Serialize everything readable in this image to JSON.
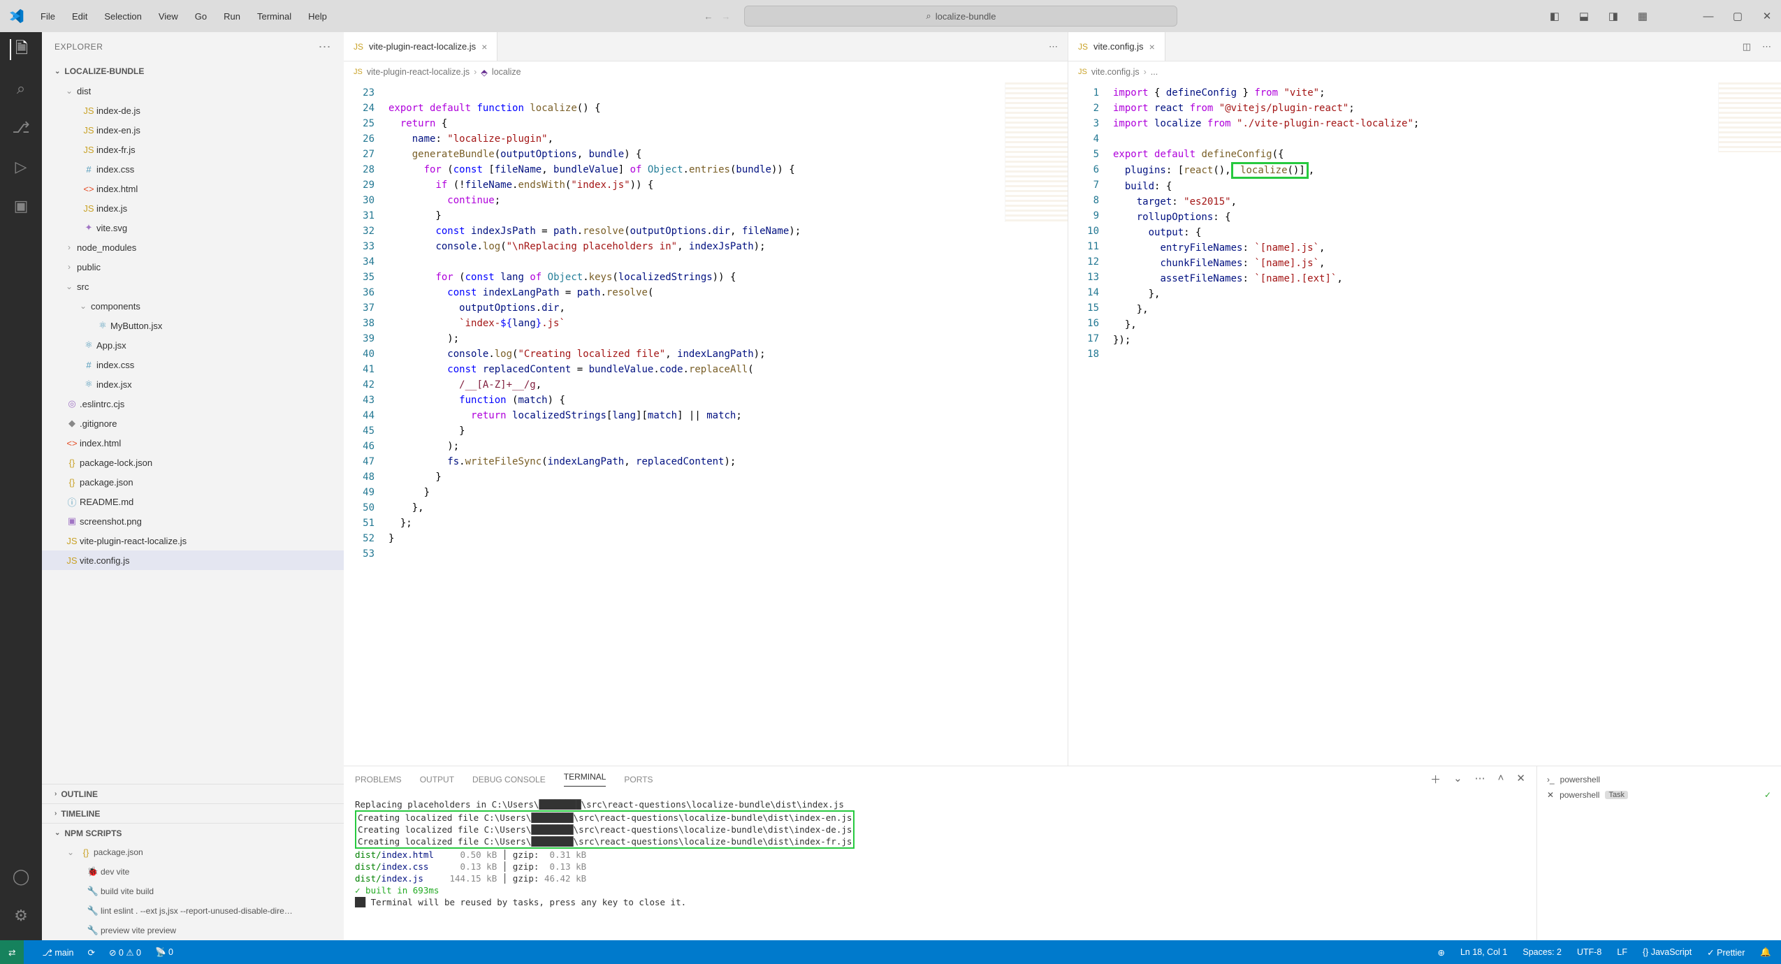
{
  "menu": [
    "File",
    "Edit",
    "Selection",
    "View",
    "Go",
    "Run",
    "Terminal",
    "Help"
  ],
  "search_value": "localize-bundle",
  "explorer_title": "EXPLORER",
  "project_name": "LOCALIZE-BUNDLE",
  "tree": {
    "dist": "dist",
    "items_dist": [
      {
        "icon": "JS",
        "cls": "js-color",
        "label": "index-de.js"
      },
      {
        "icon": "JS",
        "cls": "js-color",
        "label": "index-en.js"
      },
      {
        "icon": "JS",
        "cls": "js-color",
        "label": "index-fr.js"
      },
      {
        "icon": "#",
        "cls": "css-color",
        "label": "index.css"
      },
      {
        "icon": "<>",
        "cls": "html-color",
        "label": "index.html"
      },
      {
        "icon": "JS",
        "cls": "js-color",
        "label": "index.js"
      },
      {
        "icon": "✦",
        "cls": "img-color",
        "label": "vite.svg"
      }
    ],
    "node_modules": "node_modules",
    "public": "public",
    "src": "src",
    "components": "components",
    "mybutton": "MyButton.jsx",
    "appjsx": "App.jsx",
    "indexcss": "index.css",
    "indexjs": "index.jsx",
    "eslintrc": ".eslintrc.cjs",
    "gitignore": ".gitignore",
    "indexhtml": "index.html",
    "pkglock": "package-lock.json",
    "pkg": "package.json",
    "readme": "README.md",
    "screenshot": "screenshot.png",
    "viteplugin": "vite-plugin-react-localize.js",
    "viteconfig": "vite.config.js"
  },
  "aux": {
    "outline": "OUTLINE",
    "timeline": "TIMELINE",
    "npm": "NPM SCRIPTS"
  },
  "npm_scripts": {
    "pkg": "package.json",
    "dev": "dev vite",
    "build": "build vite build",
    "lint": "lint eslint . --ext js,jsx --report-unused-disable-dire…",
    "preview": "preview vite preview"
  },
  "tab_left": "vite-plugin-react-localize.js",
  "tab_right": "vite.config.js",
  "breadcrumbs_left": [
    "vite-plugin-react-localize.js",
    "localize"
  ],
  "breadcrumbs_right": [
    "vite.config.js",
    "..."
  ],
  "code_left_lines": [
    23,
    24,
    25,
    26,
    27,
    28,
    29,
    30,
    31,
    32,
    33,
    34,
    35,
    36,
    37,
    38,
    39,
    40,
    41,
    42,
    43,
    44,
    45,
    46,
    47,
    48,
    49,
    50,
    51,
    52,
    53
  ],
  "code_right_lines": [
    1,
    2,
    3,
    4,
    5,
    6,
    7,
    8,
    9,
    10,
    11,
    12,
    13,
    14,
    15,
    16,
    17,
    18
  ],
  "panel_tabs": [
    "PROBLEMS",
    "OUTPUT",
    "DEBUG CONSOLE",
    "TERMINAL",
    "PORTS"
  ],
  "terminal": {
    "line1": "Replacing placeholders in C:\\Users\\████████\\src\\react-questions\\localize-bundle\\dist\\index.js",
    "green_lines": [
      "Creating localized file C:\\Users\\████████\\src\\react-questions\\localize-bundle\\dist\\index-en.js",
      "Creating localized file C:\\Users\\████████\\src\\react-questions\\localize-bundle\\dist\\index-de.js",
      "Creating localized file C:\\Users\\████████\\src\\react-questions\\localize-bundle\\dist\\index-fr.js"
    ],
    "size_lines": [
      "<span class='cm'>dist/</span><span class='var'>index.html</span>     <span style='color:#888'>0.50 kB</span> │ gzip: <span style='color:#888'> 0.31 kB</span>",
      "<span class='cm'>dist/</span><span class='var'>index.css </span>     <span style='color:#888'>0.13 kB</span> │ gzip: <span style='color:#888'> 0.13 kB</span>",
      "<span class='cm'>dist/</span><span class='var'>index.js  </span>   <span style='color:#888'>144.15 kB</span> │ gzip: <span style='color:#888'>46.42 kB</span>"
    ],
    "built": "✓ built in 693ms",
    "reuse": "Terminal will be reused by tasks, press any key to close it."
  },
  "panel_side": {
    "ps1": "powershell",
    "ps2": "powershell",
    "ps2_badge": "Task"
  },
  "statusbar": {
    "branch": "main",
    "errors": "0",
    "warnings": "0",
    "radio": "0",
    "ln": "Ln 18, Col 1",
    "spaces": "Spaces: 2",
    "enc": "UTF-8",
    "eol": "LF",
    "lang": "JavaScript",
    "prettier": "Prettier"
  }
}
